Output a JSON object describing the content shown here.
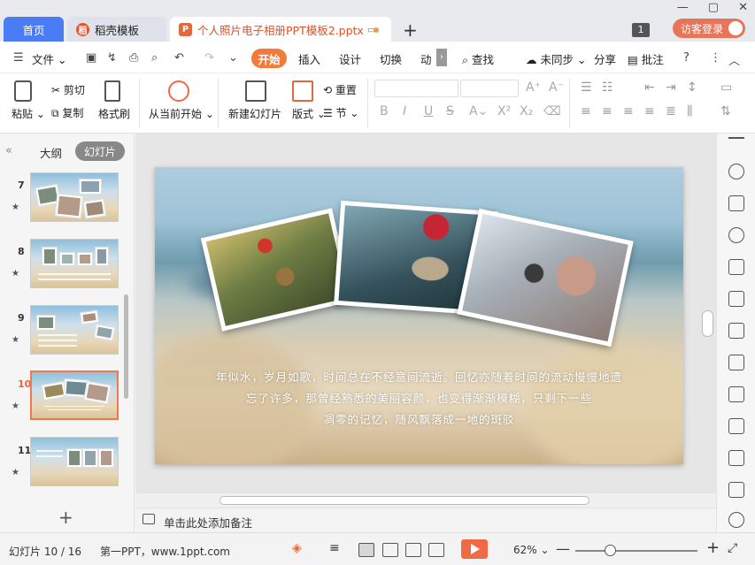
{
  "tabs": {
    "home": "首页",
    "daoke": "稻壳模板",
    "doc": "个人照片电子相册PPT模板2.pptx",
    "new_tab": "+"
  },
  "window": {
    "minimize": "—",
    "restore": "▢",
    "close": "✕",
    "badge": "1",
    "login": "访客登录"
  },
  "menu": {
    "file": "文件",
    "start": "开始",
    "insert": "插入",
    "design": "设计",
    "switch": "切换",
    "animation": "动",
    "search": "查找",
    "sync": "未同步",
    "share": "分享",
    "annotate": "批注"
  },
  "ribbon": {
    "paste": "粘贴",
    "cut": "剪切",
    "copy": "复制",
    "format_painter": "格式刷",
    "from_current": "从当前开始",
    "new_slide": "新建幻灯片",
    "layout": "版式",
    "reset": "重置",
    "section": "节"
  },
  "left_panel": {
    "outline": "大纲",
    "slides": "幻灯片",
    "thumbs": [
      {
        "num": "7"
      },
      {
        "num": "8"
      },
      {
        "num": "9"
      },
      {
        "num": "10"
      },
      {
        "num": "11"
      }
    ]
  },
  "slide": {
    "text_line1": "年似水，岁月如歌，时间总在不经意间流逝。回忆亦随着时间的流动慢慢地遗",
    "text_line2": "忘了许多，那曾经熟悉的美丽容颜，也变得渐渐模糊，只剩下一些",
    "text_line3": "凋零的记忆，随风飘落成一地的斑驳"
  },
  "notes": {
    "placeholder": "单击此处添加备注"
  },
  "status": {
    "slide_info": "幻灯片 10 / 16",
    "theme": "第一PPT，www.1ppt.com",
    "zoom": "62%"
  },
  "colors": {
    "accent": "#f47a3a",
    "home_tab": "#4a7df5",
    "play": "#f06a45",
    "selected_thumb": "#f0794d"
  }
}
